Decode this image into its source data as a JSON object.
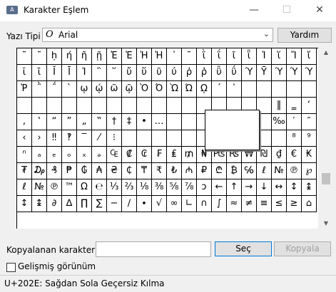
{
  "window": {
    "title": "Karakter Eşlem",
    "minimize": "—",
    "maximize": "☐",
    "close": "✕"
  },
  "font": {
    "label": "Yazı Tipi :",
    "icon_glyph": "O",
    "value": "Arial",
    "dropdown_glyph": "⌄",
    "help_label": "Yardım"
  },
  "grid": {
    "rows": [
      [
        "˜",
        "˜",
        "ḥ",
        "ή",
        "ῆ",
        "ῇ",
        "Ἐ",
        "Ἑ",
        "Ἡ",
        "Ἠ",
        "᾿",
        "῀",
        "ῒ",
        "ΐ",
        "ῖ",
        "ῗ",
        "Ἱ",
        "ἵ",
        "Ἴ",
        "ἴ"
      ],
      [
        "ῐ",
        "ῑ",
        "Ῐ",
        "Ῑ",
        "Ἱ",
        "῝",
        "῞",
        "ὔ",
        "ὕ",
        "ῦ",
        "ύ",
        "ῤ",
        "ῥ",
        "ῧ",
        "ΰ",
        "Ύ",
        "Ῡ",
        "Ύ",
        "Ύ",
        "Ύ"
      ],
      [
        "Ῥ",
        "῭",
        "΅",
        "`",
        "ῳ",
        "ῴ",
        "ῶ",
        "ῷ",
        "Ὸ",
        "Ό",
        "Ὼ",
        "Ώ",
        "ῼ",
        "´",
        "῾",
        "",
        "",
        "",
        "",
        ""
      ],
      [
        "",
        "",
        "",
        "",
        "",
        "",
        "",
        "",
        "",
        "",
        "",
        "",
        "",
        "",
        "",
        "",
        "",
        "‖",
        "‗",
        "‘"
      ],
      [
        ",",
        "‛",
        "“",
        "”",
        "„",
        "‟",
        "†",
        "‡",
        "•",
        "…",
        "",
        "",
        "",
        "",
        "",
        "",
        "",
        "‰",
        "′",
        "″"
      ],
      [
        "‹",
        "›",
        "‼",
        "‽",
        "‾",
        "⁄",
        "⁝",
        "",
        "",
        "",
        "",
        "",
        "",
        "",
        "",
        "",
        "",
        "",
        "⁸",
        "⁹"
      ],
      [
        "ⁿ",
        "ₐ",
        "ₑ",
        "ₒ",
        "ₓ",
        "ₔ",
        "₠",
        "₡",
        "₢",
        "₣",
        "₤",
        "₥",
        "₦",
        "₧",
        "₨",
        "₩",
        "₪",
        "₫",
        "€",
        "₭"
      ],
      [
        "₮",
        "₯",
        "₰",
        "₱",
        "₲",
        "₳",
        "₴",
        "₵",
        "₸",
        "₹",
        "₺",
        "₼",
        "₽",
        "₾",
        "₿",
        "℅",
        "ℓ",
        "№",
        "℗",
        "℘"
      ],
      [
        "ℓ",
        "№",
        "℗",
        "™",
        "Ω",
        "℮",
        "⅓",
        "⅔",
        "⅛",
        "⅜",
        "⅝",
        "⅞",
        "ↄ",
        "←",
        "↑",
        "→",
        "↓",
        "↔",
        "↕",
        "↨"
      ],
      [
        "↕",
        "↨",
        "∂",
        "∆",
        "∏",
        "∑",
        "−",
        "∕",
        "∙",
        "√",
        "∞",
        "∟",
        "∩",
        "∫",
        "≈",
        "≠",
        "≡",
        "≤",
        "≥",
        "⌂"
      ]
    ]
  },
  "copy": {
    "label": "Kopyalanan karakterler :",
    "value": "",
    "select_label": "Seç",
    "copy_label": "Kopyala"
  },
  "advanced": {
    "label": "Gelişmiş görünüm",
    "checked": false
  },
  "status": {
    "text": "U+202E: Sağdan Sola Geçersiz Kılma"
  },
  "scroll": {
    "up_glyph": "▲",
    "down_glyph": "▼"
  }
}
